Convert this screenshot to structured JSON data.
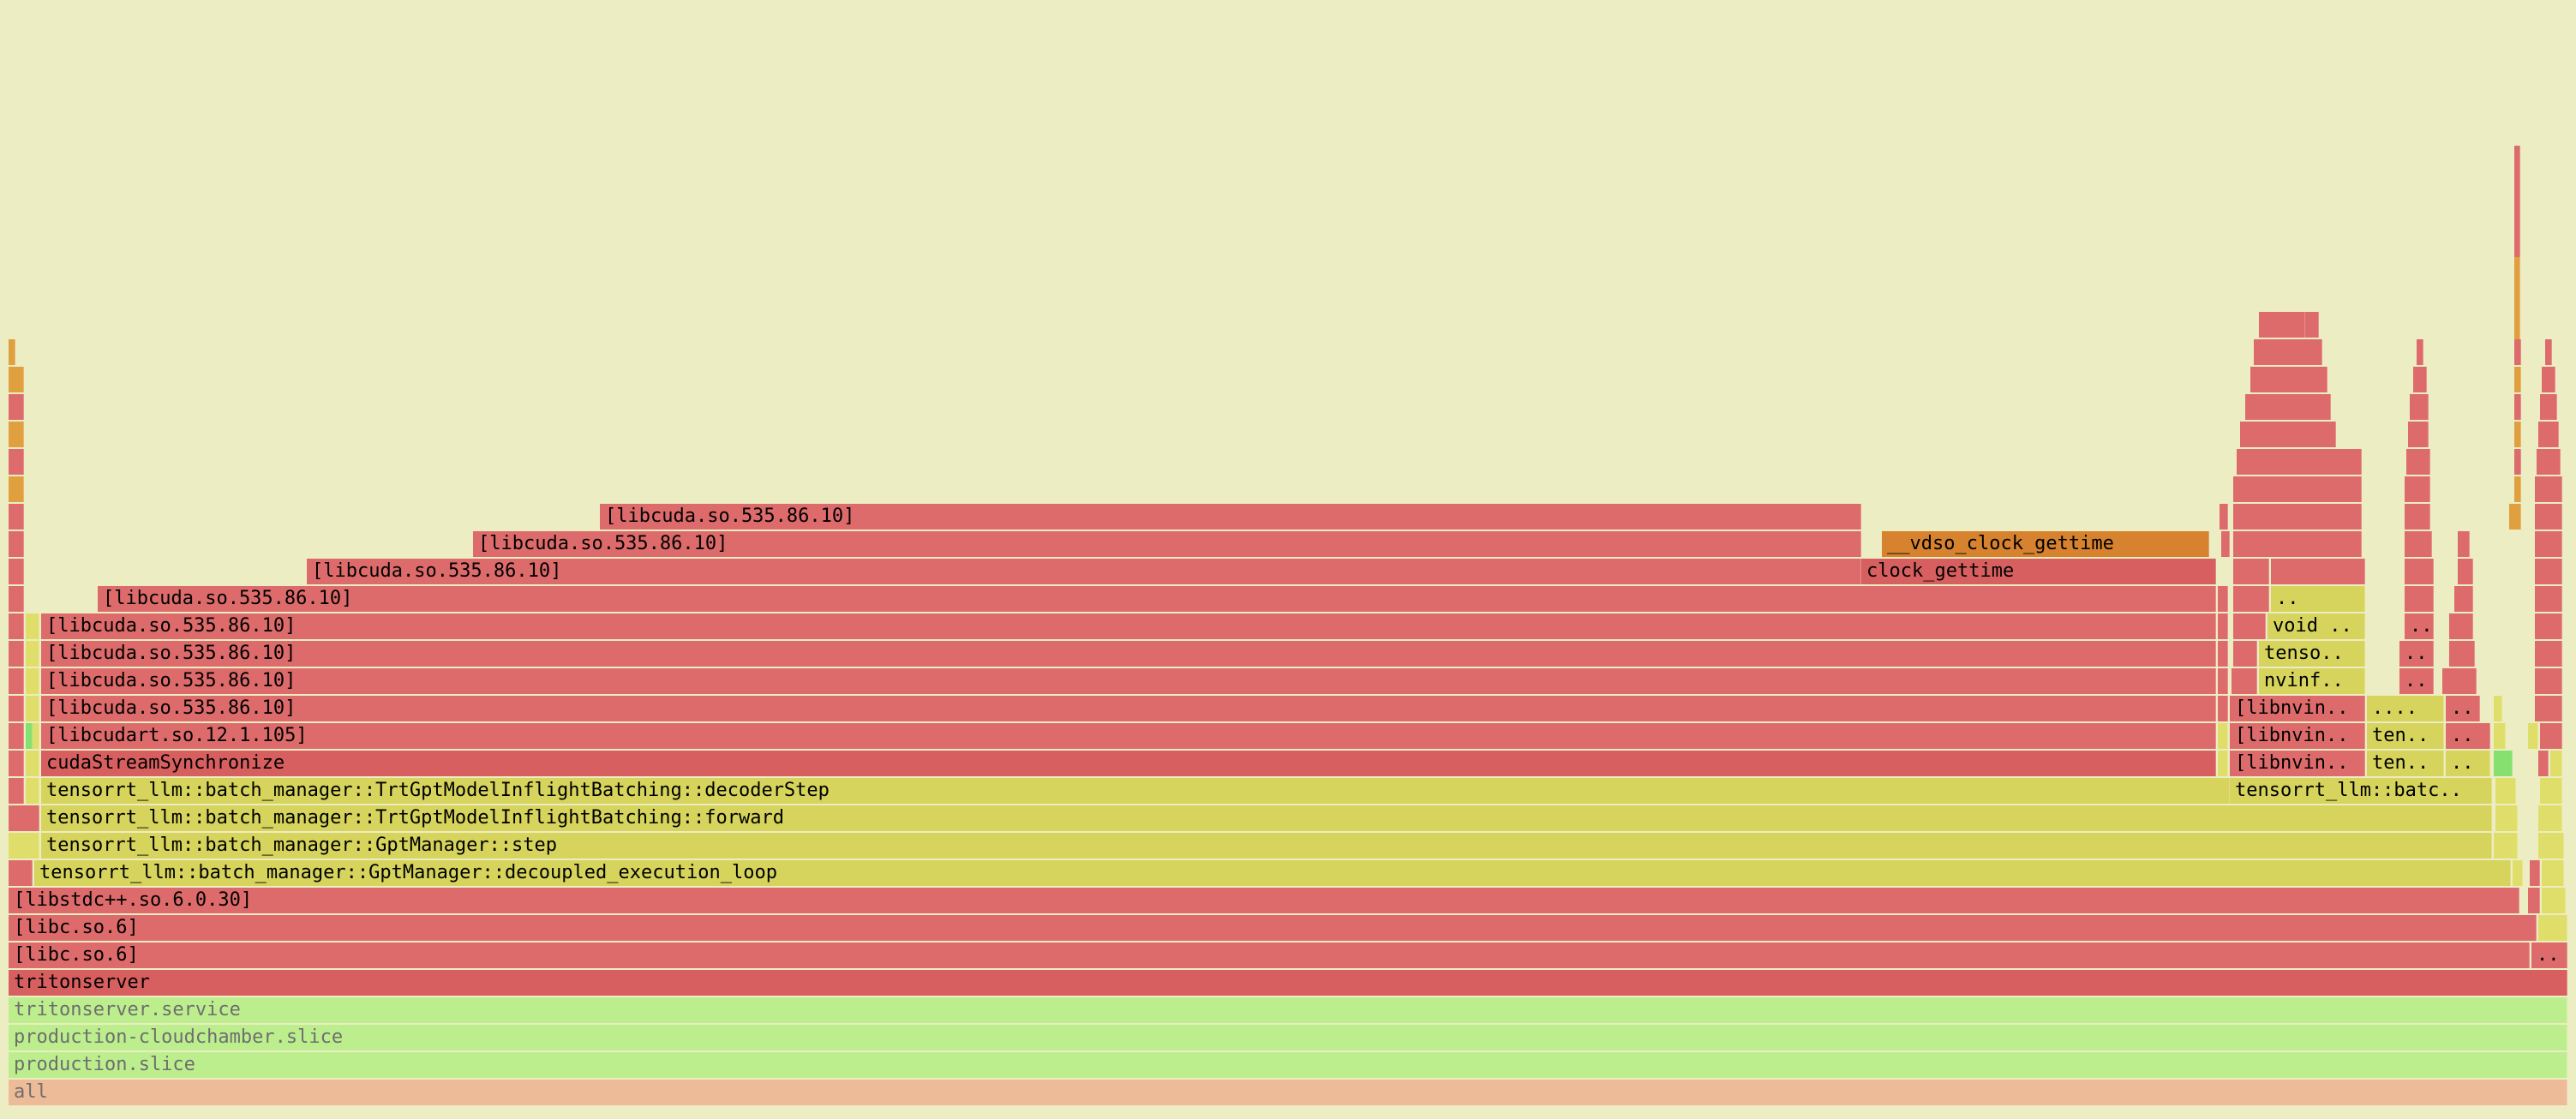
{
  "colors": {
    "background": "#ededc4",
    "red": "#de6b6b",
    "red_dark": "#d85f5f",
    "yellow": "#d6d45c",
    "yellow_light": "#e0de6a",
    "orange": "#d6822e",
    "orange_light": "#e0a040",
    "green": "#bdee8e",
    "green_bright": "#86e070",
    "salmon": "#eebb98"
  },
  "frames": {
    "all": "all",
    "production_slice": "production.slice",
    "production_cloudchamber_slice": "production-cloudchamber.slice",
    "tritonserver_service": "tritonserver.service",
    "tritonserver": "tritonserver",
    "libc_outer": "[libc.so.6]",
    "libc_outer_sibling": "..",
    "libc_inner": "[libc.so.6]",
    "libstdcxx": "[libstdc++.so.6.0.30]",
    "decoupled_execution_loop": "tensorrt_llm::batch_manager::GptManager::decoupled_execution_loop",
    "gptmanager_step": "tensorrt_llm::batch_manager::GptManager::step",
    "inflight_forward": "tensorrt_llm::batch_manager::TrtGptModelInflightBatching::forward",
    "inflight_decoder_step": "tensorrt_llm::batch_manager::TrtGptModelInflightBatching::decoderStep",
    "inflight_batc_truncated": "tensorrt_llm::batc..",
    "cuda_stream_synchronize": "cudaStreamSynchronize",
    "libnvin_1": "[libnvin..",
    "ten_1": "ten..",
    "dots_1": "..",
    "libcudart": "[libcudart.so.12.1.105]",
    "libnvin_2": "[libnvin..",
    "ten_2": "ten..",
    "dots_2": "..",
    "libcuda_1": "[libcuda.so.535.86.10]",
    "libnvin_3": "[libnvin..",
    "dots_many": "....",
    "dots_3": "..",
    "libcuda_2": "[libcuda.so.535.86.10]",
    "nvinf": "nvinf..",
    "dots_4": "..",
    "libcuda_3": "[libcuda.so.535.86.10]",
    "tenso": "tenso..",
    "dots_5": "..",
    "libcuda_4": "[libcuda.so.535.86.10]",
    "void": "void ..",
    "dots_6": "..",
    "libcuda_5": "[libcuda.so.535.86.10]",
    "dots_7": "..",
    "libcuda_6": "[libcuda.so.535.86.10]",
    "clock_gettime": "clock_gettime",
    "libcuda_7": "[libcuda.so.535.86.10]",
    "vdso_clock_gettime": "__vdso_clock_gettime",
    "libcuda_8": "[libcuda.so.535.86.10]"
  }
}
